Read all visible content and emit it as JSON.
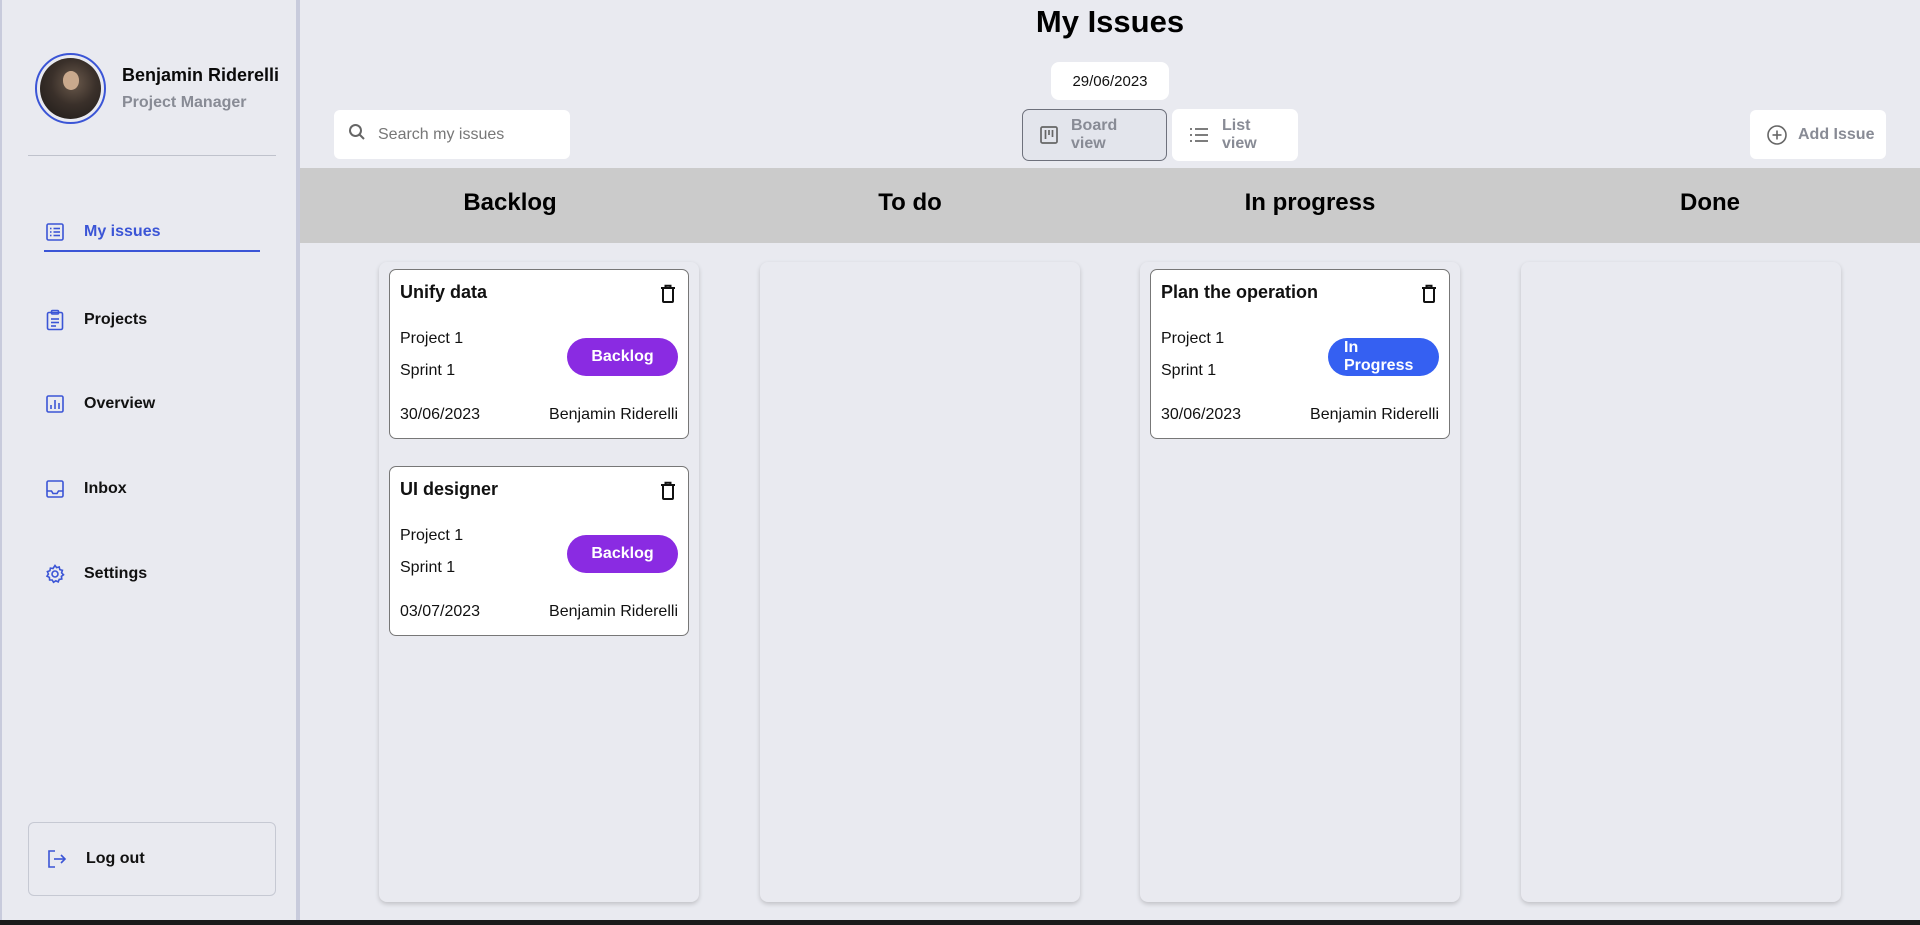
{
  "profile": {
    "name": "Benjamin Riderelli",
    "role": "Project Manager"
  },
  "nav": {
    "my_issues": "My issues",
    "projects": "Projects",
    "overview": "Overview",
    "inbox": "Inbox",
    "settings": "Settings",
    "logout": "Log out"
  },
  "header": {
    "title": "My Issues",
    "date": "29/06/2023",
    "search_placeholder": "Search my issues",
    "board_view": "Board view",
    "list_view": "List view",
    "add_issue": "Add Issue"
  },
  "columns": [
    "Backlog",
    "To do",
    "In progress",
    "Done"
  ],
  "cards": [
    {
      "title": "Unify data",
      "project": "Project 1",
      "sprint": "Sprint 1",
      "status": "Backlog",
      "date": "30/06/2023",
      "assignee": "Benjamin Riderelli"
    },
    {
      "title": "UI designer",
      "project": "Project 1",
      "sprint": "Sprint 1",
      "status": "Backlog",
      "date": "03/07/2023",
      "assignee": "Benjamin Riderelli"
    },
    {
      "title": "Plan the operation",
      "project": "Project 1",
      "sprint": "Sprint 1",
      "status": "In Progress",
      "date": "30/06/2023",
      "assignee": "Benjamin Riderelli"
    }
  ],
  "colors": {
    "accent": "#3b55d6",
    "backlog_badge": "#8a2be2",
    "progress_badge": "#3560f2",
    "column_header_bg": "#cbcbcb",
    "page_bg": "#e9eaf0"
  }
}
